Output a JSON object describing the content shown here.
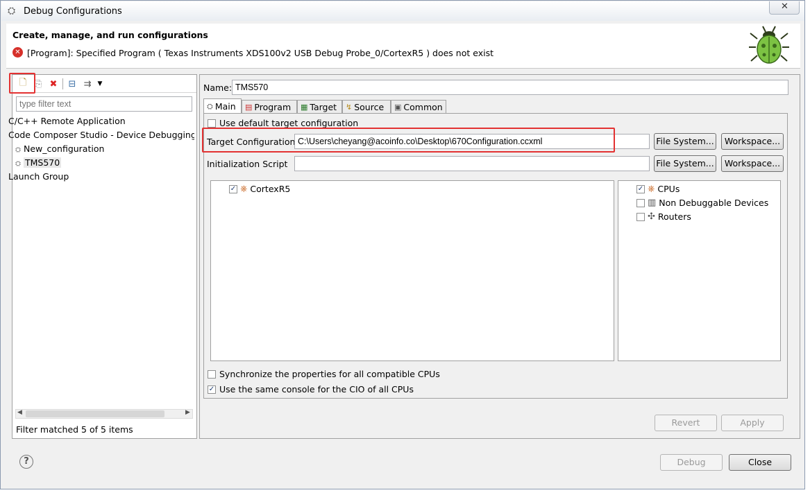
{
  "window": {
    "title": "Debug Configurations"
  },
  "header": {
    "title": "Create, manage, and run configurations",
    "error": "[Program]: Specified Program ( Texas Instruments XDS100v2 USB Debug Probe_0/CortexR5 )  does not exist"
  },
  "left": {
    "filter_placeholder": "type filter text",
    "items": [
      "C/C++ Remote Application",
      "Code Composer Studio - Device Debugging",
      "New_configuration",
      "TMS570",
      "Launch Group"
    ],
    "footer": "Filter matched 5 of 5 items"
  },
  "right": {
    "name_label": "Name:",
    "name_value": "TMS570",
    "tabs": [
      "Main",
      "Program",
      "Target",
      "Source",
      "Common"
    ],
    "use_default_label": "Use default target configuration",
    "target_config_label": "Target Configuration",
    "target_config_value": "C:\\Users\\cheyang@acoinfo.co\\Desktop\\670Configuration.ccxml",
    "init_script_label": "Initialization Script",
    "file_system": "File System...",
    "workspace": "Workspace...",
    "cpu_tree": [
      "CortexR5"
    ],
    "filters": [
      "CPUs",
      "Non Debuggable Devices",
      "Routers"
    ],
    "sync_label": "Synchronize the properties for all compatible CPUs",
    "console_label": "Use the same console for the CIO of all CPUs",
    "revert": "Revert",
    "apply": "Apply"
  },
  "bottom": {
    "debug": "Debug",
    "close": "Close",
    "help": "?"
  }
}
